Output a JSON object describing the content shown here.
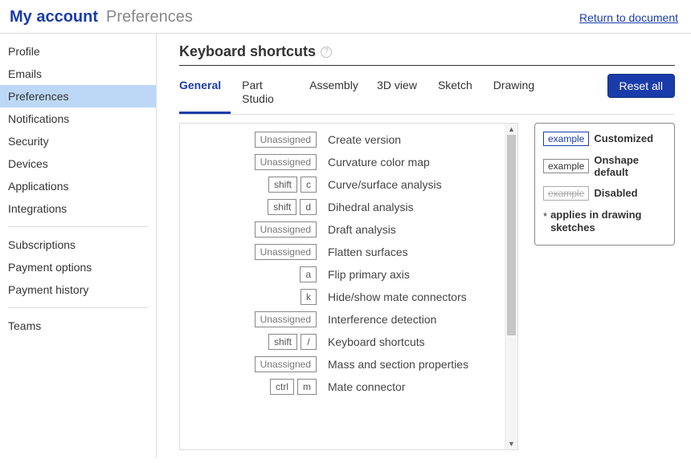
{
  "header": {
    "title": "My account",
    "subtitle": "Preferences",
    "return_link": "Return to document"
  },
  "sidebar": {
    "items": [
      {
        "label": "Profile"
      },
      {
        "label": "Emails"
      },
      {
        "label": "Preferences",
        "active": true
      },
      {
        "label": "Notifications"
      },
      {
        "label": "Security"
      },
      {
        "label": "Devices"
      },
      {
        "label": "Applications"
      },
      {
        "label": "Integrations"
      }
    ],
    "items2": [
      {
        "label": "Subscriptions"
      },
      {
        "label": "Payment options"
      },
      {
        "label": "Payment history"
      }
    ],
    "items3": [
      {
        "label": "Teams"
      }
    ]
  },
  "section": {
    "title": "Keyboard shortcuts"
  },
  "tabs": [
    {
      "label": "General",
      "active": true
    },
    {
      "label": "Part Studio"
    },
    {
      "label": "Assembly"
    },
    {
      "label": "3D view"
    },
    {
      "label": "Sketch"
    },
    {
      "label": "Drawing"
    }
  ],
  "reset_button": "Reset all",
  "unassigned_label": "Unassigned",
  "shortcuts": [
    {
      "keys": null,
      "label": "Create version"
    },
    {
      "keys": null,
      "label": "Curvature color map"
    },
    {
      "keys": [
        "shift",
        "c"
      ],
      "label": "Curve/surface analysis"
    },
    {
      "keys": [
        "shift",
        "d"
      ],
      "label": "Dihedral analysis"
    },
    {
      "keys": null,
      "label": "Draft analysis"
    },
    {
      "keys": null,
      "label": "Flatten surfaces"
    },
    {
      "keys": [
        "a"
      ],
      "label": "Flip primary axis"
    },
    {
      "keys": [
        "k"
      ],
      "label": "Hide/show mate connectors"
    },
    {
      "keys": null,
      "label": "Interference detection"
    },
    {
      "keys": [
        "shift",
        "/"
      ],
      "label": "Keyboard shortcuts"
    },
    {
      "keys": null,
      "label": "Mass and section properties"
    },
    {
      "keys": [
        "ctrl",
        "m"
      ],
      "label": "Mate connector"
    }
  ],
  "legend": {
    "example_label": "example",
    "customized": "Customized",
    "default": "Onshape default",
    "disabled": "Disabled",
    "note_star": "*",
    "note": "applies in drawing sketches"
  }
}
